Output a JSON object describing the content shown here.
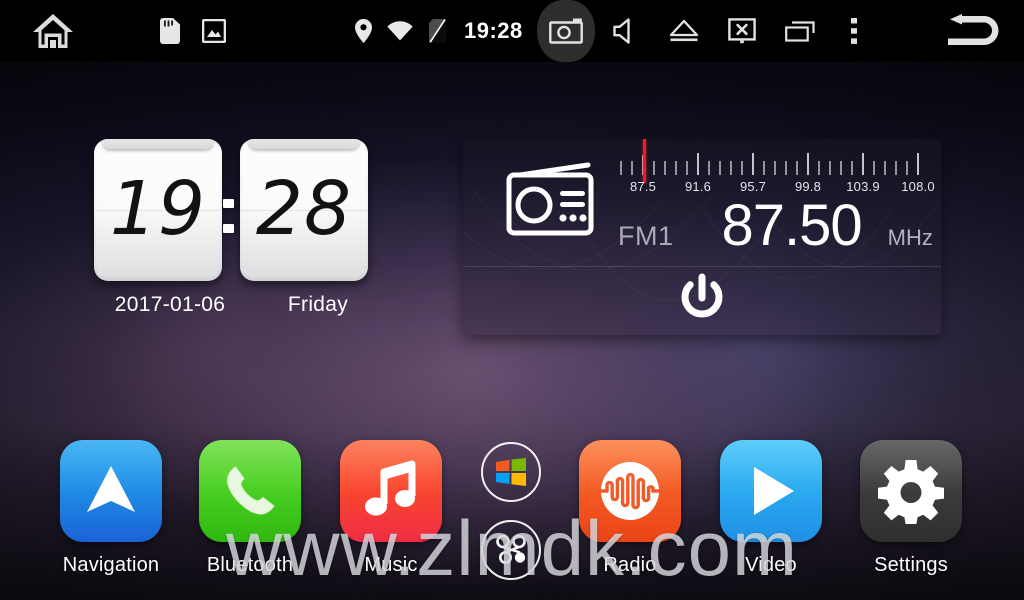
{
  "statusbar": {
    "time": "19:28",
    "icons": [
      {
        "name": "home-icon",
        "label": "Home"
      },
      {
        "name": "sd-card-icon",
        "label": "SD Card"
      },
      {
        "name": "gallery-icon",
        "label": "Gallery"
      },
      {
        "name": "location-icon",
        "label": "GPS"
      },
      {
        "name": "wifi-icon",
        "label": "Wi-Fi"
      },
      {
        "name": "sim-off-icon",
        "label": "No SIM"
      },
      {
        "name": "camera-icon",
        "label": "Camera"
      },
      {
        "name": "mute-icon",
        "label": "Mute"
      },
      {
        "name": "eject-icon",
        "label": "Eject"
      },
      {
        "name": "screen-off-icon",
        "label": "Screen Off"
      },
      {
        "name": "recent-apps-icon",
        "label": "Recent Apps"
      },
      {
        "name": "overflow-menu-icon",
        "label": "More"
      },
      {
        "name": "back-icon",
        "label": "Back"
      }
    ]
  },
  "clock": {
    "hours": "19",
    "minutes": "28",
    "date": "2017-01-06",
    "weekday": "Friday"
  },
  "radio": {
    "band": "FM1",
    "frequency": "87.50",
    "unit": "MHz",
    "power_label": "Power",
    "tuner": {
      "min": 87.5,
      "max": 108.0,
      "cursor_value": 87.5,
      "ticks": [
        "87.5",
        "91.6",
        "95.7",
        "99.8",
        "103.9",
        "108.0"
      ],
      "cursor_color": "#ee1c25"
    }
  },
  "dock": {
    "apps": [
      {
        "name": "navigation",
        "label": "Navigation",
        "icon": "navigation-arrow-icon",
        "color": "#1f8de6"
      },
      {
        "name": "bluetooth",
        "label": "Bluetooth",
        "icon": "phone-handset-icon",
        "color": "#49cf22"
      },
      {
        "name": "music",
        "label": "Music",
        "icon": "music-note-icon",
        "color": "#f9452f"
      },
      {
        "name": "radio",
        "label": "Radio",
        "icon": "radio-wave-icon",
        "color": "#f35a24"
      },
      {
        "name": "video",
        "label": "Video",
        "icon": "play-triangle-icon",
        "color": "#2aaaf0"
      },
      {
        "name": "settings",
        "label": "Settings",
        "icon": "gear-icon",
        "color": "#3b3b3b"
      }
    ],
    "circle_buttons": [
      {
        "name": "windows-mirror",
        "icon": "windows-logo-icon"
      },
      {
        "name": "link-connect",
        "icon": "link-dots-icon"
      }
    ]
  },
  "watermark": {
    "text": "www.zlmdk.com"
  }
}
